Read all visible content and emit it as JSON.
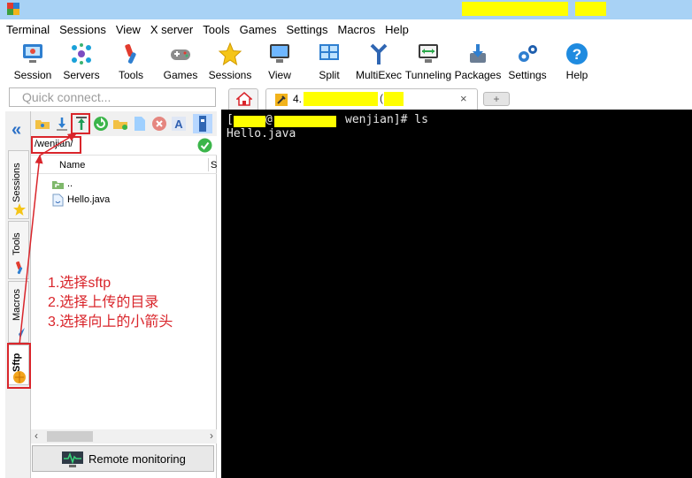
{
  "menu": [
    "Terminal",
    "Sessions",
    "View",
    "X server",
    "Tools",
    "Games",
    "Settings",
    "Macros",
    "Help"
  ],
  "toolbar": {
    "session": "Session",
    "servers": "Servers",
    "tools": "Tools",
    "games": "Games",
    "sessions": "Sessions",
    "view": "View",
    "split": "Split",
    "multiexec": "MultiExec",
    "tunneling": "Tunneling",
    "packages": "Packages",
    "settings": "Settings",
    "help": "Help"
  },
  "quick_connect": {
    "placeholder": "Quick connect..."
  },
  "side_tabs": {
    "sessions": "Sessions",
    "tools": "Tools",
    "macros": "Macros",
    "sftp": "Sftp"
  },
  "sftp": {
    "path": "/wenjian/",
    "column_name": "Name",
    "column_size": "S",
    "files": [
      "..",
      "Hello.java"
    ],
    "remote_monitoring": "Remote monitoring"
  },
  "tabs": {
    "session_number": "4.",
    "paren": "(",
    "close": "×",
    "add": "+"
  },
  "terminal": {
    "prompt_open": "[",
    "prompt_at": "@",
    "prompt_dir": "wenjian]# ls",
    "output": "Hello.java"
  },
  "annotation": {
    "step1": "1.选择sftp",
    "step2": "2.选择上传的目录",
    "step3": "3.选择向上的小箭头"
  },
  "colors": {
    "annotation_red": "#d9252b",
    "redaction_yellow": "#ffff00",
    "terminal_bg": "#000000",
    "accent_blue": "#2b70c7"
  }
}
